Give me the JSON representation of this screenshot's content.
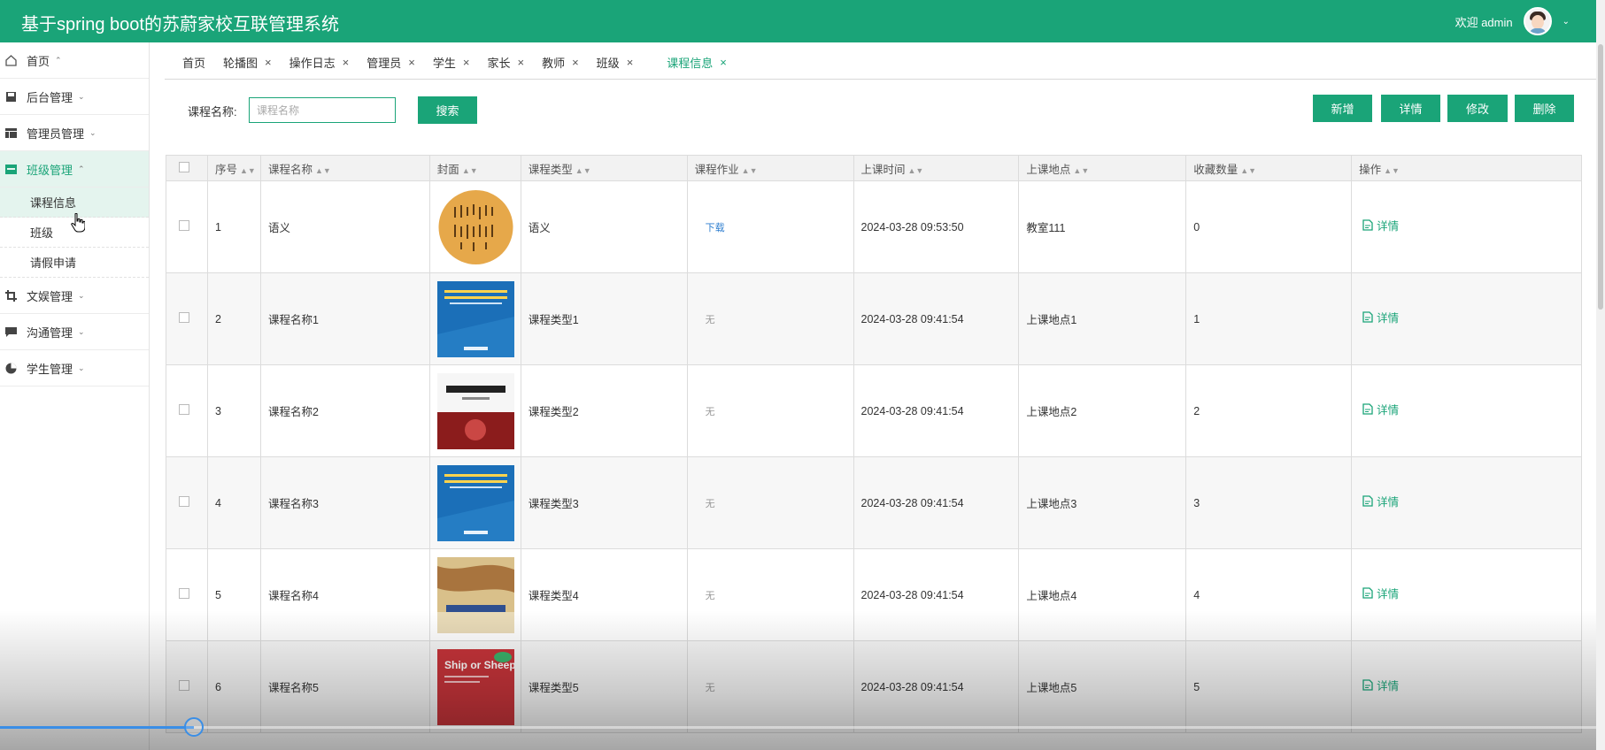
{
  "header": {
    "title": "基于spring boot的苏蔚家校互联管理系统",
    "welcome": "欢迎 admin"
  },
  "sidebar": {
    "items": [
      {
        "label": "首页",
        "icon": "home-icon",
        "arrow": "^"
      },
      {
        "label": "后台管理",
        "icon": "save-icon",
        "arrow": "v"
      },
      {
        "label": "管理员管理",
        "icon": "layout-icon",
        "arrow": "v"
      },
      {
        "label": "班级管理",
        "icon": "class-icon",
        "arrow": "^",
        "active": true
      },
      {
        "label": "文娱管理",
        "icon": "crop-icon",
        "arrow": "v"
      },
      {
        "label": "沟通管理",
        "icon": "chat-icon",
        "arrow": "v"
      },
      {
        "label": "学生管理",
        "icon": "pie-icon",
        "arrow": "v"
      }
    ],
    "subitems": [
      {
        "label": "课程信息",
        "active": true
      },
      {
        "label": "班级"
      },
      {
        "label": "请假申请"
      }
    ]
  },
  "tabs": [
    {
      "label": "首页",
      "closable": false
    },
    {
      "label": "轮播图",
      "closable": true
    },
    {
      "label": "操作日志",
      "closable": true
    },
    {
      "label": "管理员",
      "closable": true
    },
    {
      "label": "学生",
      "closable": true
    },
    {
      "label": "家长",
      "closable": true
    },
    {
      "label": "教师",
      "closable": true
    },
    {
      "label": "班级",
      "closable": true
    },
    {
      "label": "课程信息",
      "closable": true,
      "active": true
    }
  ],
  "search": {
    "label": "课程名称:",
    "placeholder": "课程名称",
    "button": "搜索"
  },
  "actions": {
    "add": "新增",
    "detail": "详情",
    "edit": "修改",
    "delete": "删除"
  },
  "table": {
    "headers": [
      "序号",
      "课程名称",
      "封面",
      "课程类型",
      "课程作业",
      "上课时间",
      "上课地点",
      "收藏数量",
      "操作"
    ],
    "rows": [
      {
        "no": "1",
        "name": "语义",
        "cover": "calligraphy",
        "type": "语义",
        "homework": "下载",
        "homework_link": true,
        "time": "2024-03-28 09:53:50",
        "place": "教室111",
        "fav": "0",
        "op": "详情"
      },
      {
        "no": "2",
        "name": "课程名称1",
        "cover": "blue-book",
        "type": "课程类型1",
        "homework": "无",
        "homework_link": false,
        "time": "2024-03-28 09:41:54",
        "place": "上课地点1",
        "fav": "1",
        "op": "详情"
      },
      {
        "no": "3",
        "name": "课程名称2",
        "cover": "econ-book",
        "type": "课程类型2",
        "homework": "无",
        "homework_link": false,
        "time": "2024-03-28 09:41:54",
        "place": "上课地点2",
        "fav": "2",
        "op": "详情"
      },
      {
        "no": "4",
        "name": "课程名称3",
        "cover": "blue-book",
        "type": "课程类型3",
        "homework": "无",
        "homework_link": false,
        "time": "2024-03-28 09:41:54",
        "place": "上课地点3",
        "fav": "3",
        "op": "详情"
      },
      {
        "no": "5",
        "name": "课程名称4",
        "cover": "map-book",
        "type": "课程类型4",
        "homework": "无",
        "homework_link": false,
        "time": "2024-03-28 09:41:54",
        "place": "上课地点4",
        "fav": "4",
        "op": "详情"
      },
      {
        "no": "6",
        "name": "课程名称5",
        "cover": "red-book",
        "type": "课程类型5",
        "homework": "无",
        "homework_link": false,
        "time": "2024-03-28 09:41:54",
        "place": "上课地点5",
        "fav": "5",
        "op": "详情"
      }
    ]
  },
  "colors": {
    "primary": "#1aa478",
    "link": "#2e7ecf",
    "progress": "#3a8ee6"
  },
  "video": {
    "progress_fraction": 0.12
  }
}
